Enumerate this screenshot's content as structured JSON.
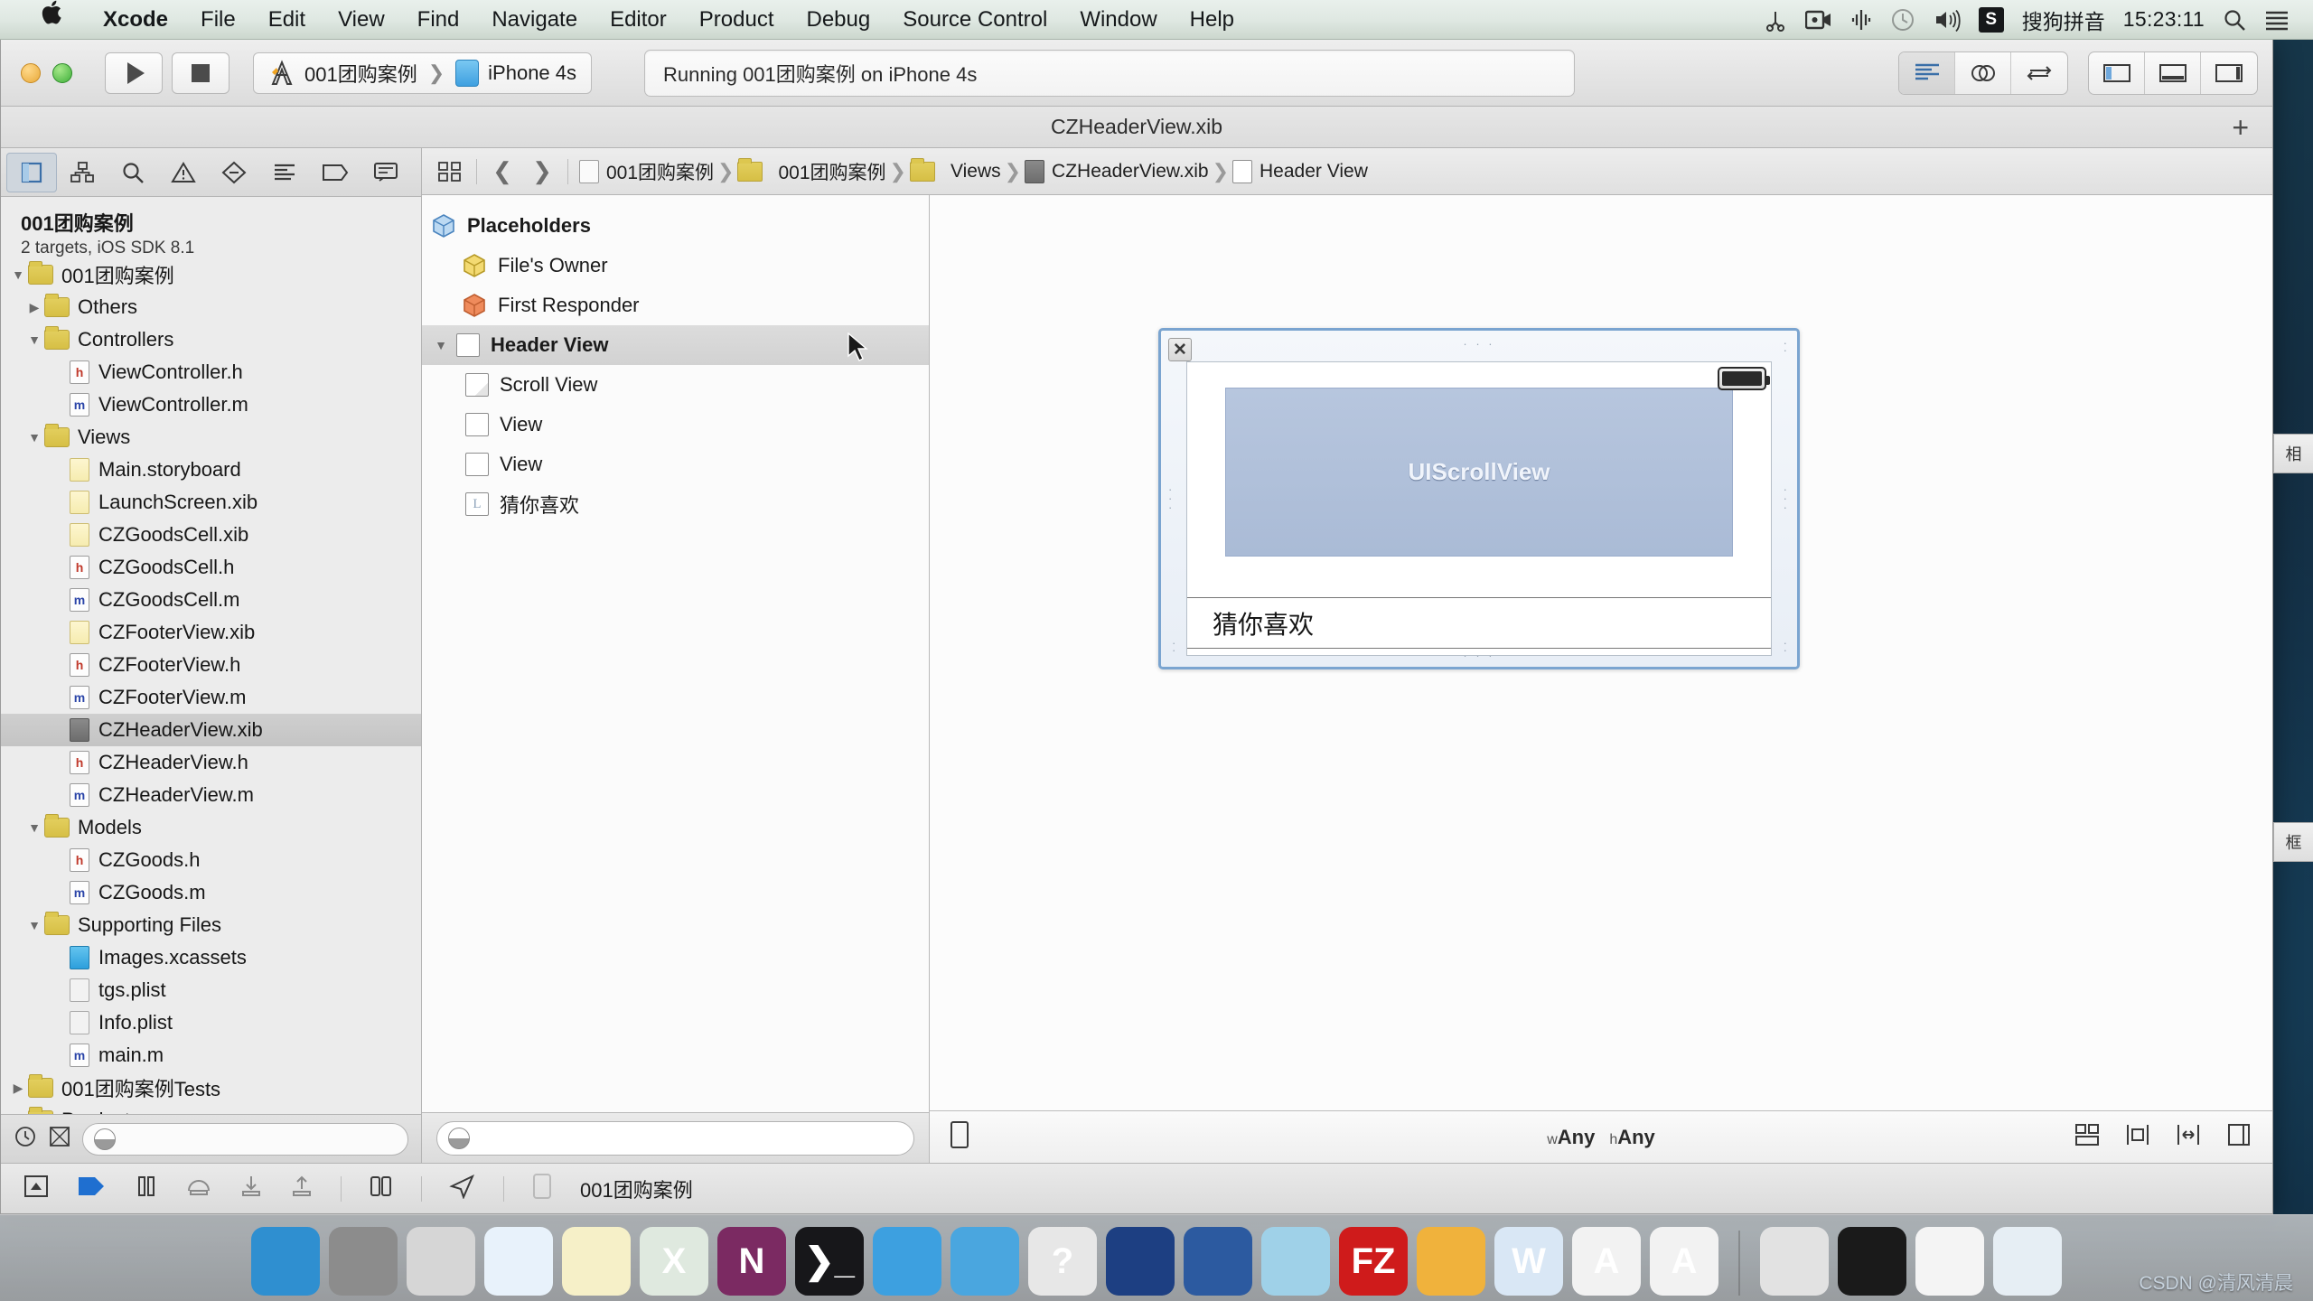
{
  "menubar": {
    "apple_icon": "apple-logo",
    "items": [
      {
        "label": "Xcode",
        "bold": true
      },
      {
        "label": "File",
        "bold": false
      },
      {
        "label": "Edit",
        "bold": false
      },
      {
        "label": "View",
        "bold": false
      },
      {
        "label": "Find",
        "bold": false
      },
      {
        "label": "Navigate",
        "bold": false
      },
      {
        "label": "Editor",
        "bold": false
      },
      {
        "label": "Product",
        "bold": false
      },
      {
        "label": "Debug",
        "bold": false
      },
      {
        "label": "Source Control",
        "bold": false
      },
      {
        "label": "Window",
        "bold": false
      },
      {
        "label": "Help",
        "bold": false
      }
    ],
    "status_icons": [
      "scissors-icon",
      "screen-record-icon",
      "audio-meter-icon",
      "time-machine-icon",
      "volume-icon"
    ],
    "ime_badge": "S",
    "ime_label": "搜狗拼音",
    "clock": "15:23:11",
    "search_icon": "search-icon",
    "notification_icon": "notification-center-icon"
  },
  "toolbar": {
    "run_button": "run-button",
    "stop_button": "stop-button",
    "scheme_name": "001团购案例",
    "scheme_separator": "❯",
    "destination": "iPhone 4s",
    "status_text": "Running 001团购案例 on iPhone 4s",
    "editor_segments": [
      "standard-editor",
      "assistant-editor",
      "version-editor"
    ],
    "view_segments": [
      "toggle-navigator",
      "toggle-debug-area",
      "toggle-utilities"
    ]
  },
  "window": {
    "title": "CZHeaderView.xib",
    "add_tab": "+"
  },
  "navigator": {
    "tabs": [
      "project-navigator",
      "symbol-navigator",
      "find-navigator",
      "issue-navigator",
      "test-navigator",
      "debug-navigator",
      "breakpoint-navigator",
      "report-navigator"
    ],
    "project_title": "001团购案例",
    "project_subtitle": "2 targets, iOS SDK 8.1",
    "tree": [
      {
        "label": "001团购案例",
        "indent": 0,
        "twisty": "open",
        "icon": "folder",
        "selected": false
      },
      {
        "label": "Others",
        "indent": 1,
        "twisty": "closed",
        "icon": "folder",
        "selected": false
      },
      {
        "label": "Controllers",
        "indent": 1,
        "twisty": "open",
        "icon": "folder",
        "selected": false
      },
      {
        "label": "ViewController.h",
        "indent": 2,
        "twisty": "none",
        "icon": "h",
        "selected": false
      },
      {
        "label": "ViewController.m",
        "indent": 2,
        "twisty": "none",
        "icon": "m",
        "selected": false
      },
      {
        "label": "Views",
        "indent": 1,
        "twisty": "open",
        "icon": "folder",
        "selected": false
      },
      {
        "label": "Main.storyboard",
        "indent": 2,
        "twisty": "none",
        "icon": "storyboard",
        "selected": false
      },
      {
        "label": "LaunchScreen.xib",
        "indent": 2,
        "twisty": "none",
        "icon": "xib",
        "selected": false
      },
      {
        "label": "CZGoodsCell.xib",
        "indent": 2,
        "twisty": "none",
        "icon": "xib",
        "selected": false
      },
      {
        "label": "CZGoodsCell.h",
        "indent": 2,
        "twisty": "none",
        "icon": "h",
        "selected": false
      },
      {
        "label": "CZGoodsCell.m",
        "indent": 2,
        "twisty": "none",
        "icon": "m",
        "selected": false
      },
      {
        "label": "CZFooterView.xib",
        "indent": 2,
        "twisty": "none",
        "icon": "xib",
        "selected": false
      },
      {
        "label": "CZFooterView.h",
        "indent": 2,
        "twisty": "none",
        "icon": "h",
        "selected": false
      },
      {
        "label": "CZFooterView.m",
        "indent": 2,
        "twisty": "none",
        "icon": "m",
        "selected": false
      },
      {
        "label": "CZHeaderView.xib",
        "indent": 2,
        "twisty": "none",
        "icon": "selxib",
        "selected": true
      },
      {
        "label": "CZHeaderView.h",
        "indent": 2,
        "twisty": "none",
        "icon": "h",
        "selected": false
      },
      {
        "label": "CZHeaderView.m",
        "indent": 2,
        "twisty": "none",
        "icon": "m",
        "selected": false
      },
      {
        "label": "Models",
        "indent": 1,
        "twisty": "open",
        "icon": "folder",
        "selected": false
      },
      {
        "label": "CZGoods.h",
        "indent": 2,
        "twisty": "none",
        "icon": "h",
        "selected": false
      },
      {
        "label": "CZGoods.m",
        "indent": 2,
        "twisty": "none",
        "icon": "m",
        "selected": false
      },
      {
        "label": "Supporting Files",
        "indent": 1,
        "twisty": "open",
        "icon": "folder",
        "selected": false
      },
      {
        "label": "Images.xcassets",
        "indent": 2,
        "twisty": "none",
        "icon": "xcassets",
        "selected": false
      },
      {
        "label": "tgs.plist",
        "indent": 2,
        "twisty": "none",
        "icon": "plist",
        "selected": false
      },
      {
        "label": "Info.plist",
        "indent": 2,
        "twisty": "none",
        "icon": "plist",
        "selected": false
      },
      {
        "label": "main.m",
        "indent": 2,
        "twisty": "none",
        "icon": "m",
        "selected": false
      },
      {
        "label": "001团购案例Tests",
        "indent": 0,
        "twisty": "closed",
        "icon": "folder",
        "selected": false
      },
      {
        "label": "Products",
        "indent": 0,
        "twisty": "closed",
        "icon": "folder",
        "selected": false
      }
    ],
    "filter_placeholder": "",
    "footer_icons": [
      "recent-files-icon",
      "source-control-icon",
      "filter-cloud-icon"
    ]
  },
  "jumpbar": {
    "related_items_icon": "related-items-icon",
    "back_arrow": "❮",
    "forward_arrow": "❯",
    "breadcrumbs": [
      {
        "label": "001团购案例",
        "icon": "project"
      },
      {
        "label": "001团购案例",
        "icon": "folder"
      },
      {
        "label": "Views",
        "icon": "folder"
      },
      {
        "label": "CZHeaderView.xib",
        "icon": "xib"
      },
      {
        "label": "Header View",
        "icon": "view"
      }
    ],
    "separator": "❯"
  },
  "outline": {
    "rows": [
      {
        "label": "Placeholders",
        "indent": 0,
        "icon": "cube-blue",
        "bold": true,
        "twisty": "none",
        "selected": false
      },
      {
        "label": "File's Owner",
        "indent": 1,
        "icon": "cube-yellow",
        "bold": false,
        "twisty": "none",
        "selected": false
      },
      {
        "label": "First Responder",
        "indent": 1,
        "icon": "cube-orange",
        "bold": false,
        "twisty": "none",
        "selected": false
      },
      {
        "label": "Header View",
        "indent": 0,
        "icon": "view-box",
        "bold": true,
        "twisty": "open",
        "selected": true
      },
      {
        "label": "Scroll View",
        "indent": 2,
        "icon": "scroll-box",
        "bold": false,
        "twisty": "none",
        "selected": false
      },
      {
        "label": "View",
        "indent": 2,
        "icon": "view-box",
        "bold": false,
        "twisty": "none",
        "selected": false
      },
      {
        "label": "View",
        "indent": 2,
        "icon": "view-box",
        "bold": false,
        "twisty": "none",
        "selected": false
      },
      {
        "label": "猜你喜欢",
        "indent": 2,
        "icon": "label-box",
        "bold": false,
        "twisty": "none",
        "selected": false
      }
    ],
    "label_glyph": "L",
    "footer_icon": "filter-cloud-icon"
  },
  "canvas": {
    "close_glyph": "✕",
    "scrollview_label": "UIScrollView",
    "footer_label": "猜你喜欢",
    "battery_icon": "battery-icon",
    "handle_dots": "· · ·"
  },
  "canvasbar": {
    "device_icon": "device-preview-icon",
    "size_class_w_prefix": "w",
    "size_class_w": "Any",
    "size_class_h_prefix": "h",
    "size_class_h": "Any",
    "right_icons": [
      "stack-icon",
      "align-icon",
      "pin-icon",
      "resolve-icon",
      "resize-icon"
    ]
  },
  "debugbar": {
    "icons": [
      "show-debug-area",
      "continue-icon",
      "pause-icon",
      "step-over-icon",
      "step-into-icon",
      "step-out-icon",
      "view-hierarchy-icon",
      "location-icon",
      "simulate-icon"
    ],
    "process_label": "001团购案例"
  },
  "edge_tabs": [
    {
      "label": "相",
      "name": "edge-tab-upper"
    },
    {
      "label": "框",
      "name": "edge-tab-lower"
    }
  ],
  "dock": {
    "left_apps": [
      {
        "name": "finder",
        "glyph": "",
        "bg": "#2f8fd0",
        "running": true
      },
      {
        "name": "system-preferences",
        "glyph": "",
        "bg": "#8c8c8c",
        "running": false
      },
      {
        "name": "launchpad",
        "glyph": "",
        "bg": "#d6d6d6",
        "running": false
      },
      {
        "name": "safari",
        "glyph": "",
        "bg": "#e8f2fb",
        "running": false
      },
      {
        "name": "stickies",
        "glyph": "",
        "bg": "#f6f0c8",
        "running": false
      },
      {
        "name": "excel",
        "glyph": "X",
        "bg": "#dfe9df",
        "running": false
      },
      {
        "name": "onenote",
        "glyph": "N",
        "bg": "#7b2a62",
        "running": false
      },
      {
        "name": "terminal",
        "glyph": "❯_",
        "bg": "#17171a",
        "running": false
      },
      {
        "name": "xcode",
        "glyph": "",
        "bg": "#3da0e0",
        "running": true
      },
      {
        "name": "simulator",
        "glyph": "",
        "bg": "#4aa6df",
        "running": true
      },
      {
        "name": "dash-docs",
        "glyph": "?",
        "bg": "#e7e7e7",
        "running": true
      },
      {
        "name": "snip-tool",
        "glyph": "",
        "bg": "#1d3f82",
        "running": false
      },
      {
        "name": "quicktime",
        "glyph": "",
        "bg": "#2c5aa0",
        "running": false
      },
      {
        "name": "teamviewer",
        "glyph": "",
        "bg": "#9fd1e8",
        "running": false
      },
      {
        "name": "filezilla",
        "glyph": "FZ",
        "bg": "#cf1b1b",
        "running": false
      },
      {
        "name": "sketchbook",
        "glyph": "",
        "bg": "#f0b23c",
        "running": true
      },
      {
        "name": "word",
        "glyph": "W",
        "bg": "#d9e7f5",
        "running": false
      },
      {
        "name": "note-app-1",
        "glyph": "A",
        "bg": "#f2f2f2",
        "running": true
      },
      {
        "name": "note-app-2",
        "glyph": "A",
        "bg": "#f2f2f2",
        "running": true
      }
    ],
    "right_apps": [
      {
        "name": "downloads-stack",
        "glyph": "",
        "bg": "#e2e2e2",
        "running": false
      },
      {
        "name": "screen-share",
        "glyph": "",
        "bg": "#1a1a1a",
        "running": false
      },
      {
        "name": "documents-stack",
        "glyph": "",
        "bg": "#f4f4f4",
        "running": false
      },
      {
        "name": "trash",
        "glyph": "",
        "bg": "#e6eef4",
        "running": false
      }
    ]
  },
  "watermark": "CSDN @清风清晨"
}
